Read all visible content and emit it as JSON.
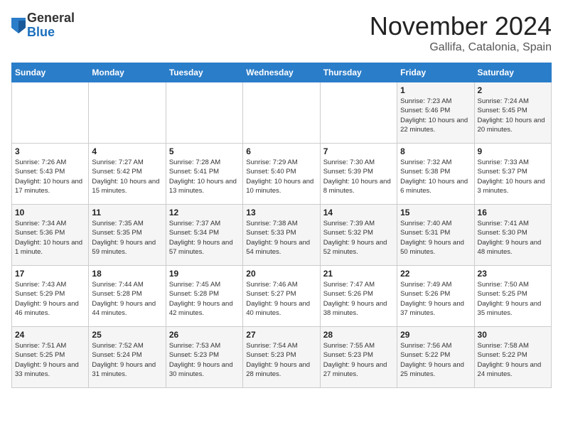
{
  "header": {
    "logo_general": "General",
    "logo_blue": "Blue",
    "month_title": "November 2024",
    "location": "Gallifa, Catalonia, Spain"
  },
  "days_of_week": [
    "Sunday",
    "Monday",
    "Tuesday",
    "Wednesday",
    "Thursday",
    "Friday",
    "Saturday"
  ],
  "weeks": [
    [
      {
        "day": "",
        "info": ""
      },
      {
        "day": "",
        "info": ""
      },
      {
        "day": "",
        "info": ""
      },
      {
        "day": "",
        "info": ""
      },
      {
        "day": "",
        "info": ""
      },
      {
        "day": "1",
        "info": "Sunrise: 7:23 AM\nSunset: 5:46 PM\nDaylight: 10 hours\nand 22 minutes."
      },
      {
        "day": "2",
        "info": "Sunrise: 7:24 AM\nSunset: 5:45 PM\nDaylight: 10 hours\nand 20 minutes."
      }
    ],
    [
      {
        "day": "3",
        "info": "Sunrise: 7:26 AM\nSunset: 5:43 PM\nDaylight: 10 hours\nand 17 minutes."
      },
      {
        "day": "4",
        "info": "Sunrise: 7:27 AM\nSunset: 5:42 PM\nDaylight: 10 hours\nand 15 minutes."
      },
      {
        "day": "5",
        "info": "Sunrise: 7:28 AM\nSunset: 5:41 PM\nDaylight: 10 hours\nand 13 minutes."
      },
      {
        "day": "6",
        "info": "Sunrise: 7:29 AM\nSunset: 5:40 PM\nDaylight: 10 hours\nand 10 minutes."
      },
      {
        "day": "7",
        "info": "Sunrise: 7:30 AM\nSunset: 5:39 PM\nDaylight: 10 hours\nand 8 minutes."
      },
      {
        "day": "8",
        "info": "Sunrise: 7:32 AM\nSunset: 5:38 PM\nDaylight: 10 hours\nand 6 minutes."
      },
      {
        "day": "9",
        "info": "Sunrise: 7:33 AM\nSunset: 5:37 PM\nDaylight: 10 hours\nand 3 minutes."
      }
    ],
    [
      {
        "day": "10",
        "info": "Sunrise: 7:34 AM\nSunset: 5:36 PM\nDaylight: 10 hours\nand 1 minute."
      },
      {
        "day": "11",
        "info": "Sunrise: 7:35 AM\nSunset: 5:35 PM\nDaylight: 9 hours\nand 59 minutes."
      },
      {
        "day": "12",
        "info": "Sunrise: 7:37 AM\nSunset: 5:34 PM\nDaylight: 9 hours\nand 57 minutes."
      },
      {
        "day": "13",
        "info": "Sunrise: 7:38 AM\nSunset: 5:33 PM\nDaylight: 9 hours\nand 54 minutes."
      },
      {
        "day": "14",
        "info": "Sunrise: 7:39 AM\nSunset: 5:32 PM\nDaylight: 9 hours\nand 52 minutes."
      },
      {
        "day": "15",
        "info": "Sunrise: 7:40 AM\nSunset: 5:31 PM\nDaylight: 9 hours\nand 50 minutes."
      },
      {
        "day": "16",
        "info": "Sunrise: 7:41 AM\nSunset: 5:30 PM\nDaylight: 9 hours\nand 48 minutes."
      }
    ],
    [
      {
        "day": "17",
        "info": "Sunrise: 7:43 AM\nSunset: 5:29 PM\nDaylight: 9 hours\nand 46 minutes."
      },
      {
        "day": "18",
        "info": "Sunrise: 7:44 AM\nSunset: 5:28 PM\nDaylight: 9 hours\nand 44 minutes."
      },
      {
        "day": "19",
        "info": "Sunrise: 7:45 AM\nSunset: 5:28 PM\nDaylight: 9 hours\nand 42 minutes."
      },
      {
        "day": "20",
        "info": "Sunrise: 7:46 AM\nSunset: 5:27 PM\nDaylight: 9 hours\nand 40 minutes."
      },
      {
        "day": "21",
        "info": "Sunrise: 7:47 AM\nSunset: 5:26 PM\nDaylight: 9 hours\nand 38 minutes."
      },
      {
        "day": "22",
        "info": "Sunrise: 7:49 AM\nSunset: 5:26 PM\nDaylight: 9 hours\nand 37 minutes."
      },
      {
        "day": "23",
        "info": "Sunrise: 7:50 AM\nSunset: 5:25 PM\nDaylight: 9 hours\nand 35 minutes."
      }
    ],
    [
      {
        "day": "24",
        "info": "Sunrise: 7:51 AM\nSunset: 5:25 PM\nDaylight: 9 hours\nand 33 minutes."
      },
      {
        "day": "25",
        "info": "Sunrise: 7:52 AM\nSunset: 5:24 PM\nDaylight: 9 hours\nand 31 minutes."
      },
      {
        "day": "26",
        "info": "Sunrise: 7:53 AM\nSunset: 5:23 PM\nDaylight: 9 hours\nand 30 minutes."
      },
      {
        "day": "27",
        "info": "Sunrise: 7:54 AM\nSunset: 5:23 PM\nDaylight: 9 hours\nand 28 minutes."
      },
      {
        "day": "28",
        "info": "Sunrise: 7:55 AM\nSunset: 5:23 PM\nDaylight: 9 hours\nand 27 minutes."
      },
      {
        "day": "29",
        "info": "Sunrise: 7:56 AM\nSunset: 5:22 PM\nDaylight: 9 hours\nand 25 minutes."
      },
      {
        "day": "30",
        "info": "Sunrise: 7:58 AM\nSunset: 5:22 PM\nDaylight: 9 hours\nand 24 minutes."
      }
    ]
  ]
}
